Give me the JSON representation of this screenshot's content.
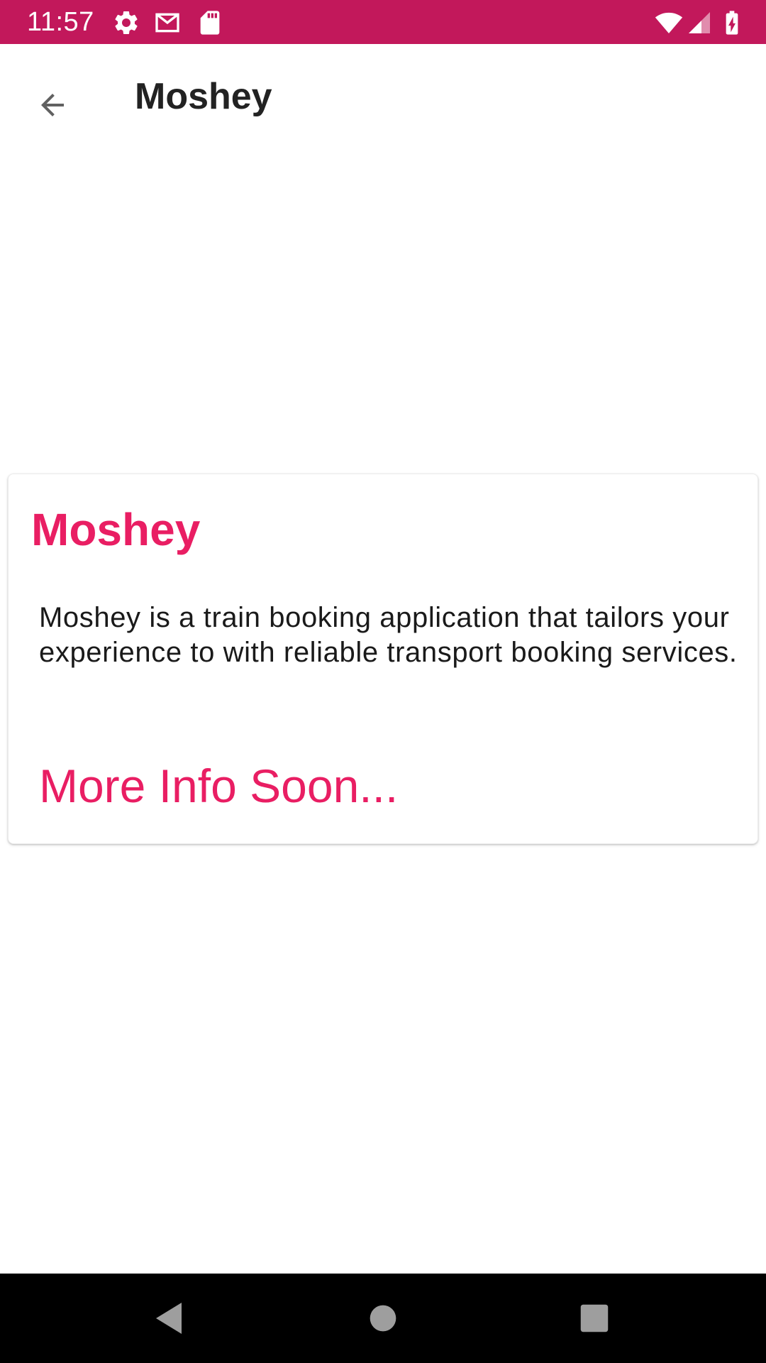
{
  "colors": {
    "status_bar": "#C2185B",
    "accent": "#E91E63",
    "nav_bar": "#000000",
    "nav_icon": "#9E9E9E"
  },
  "status_bar": {
    "time": "11:57",
    "left_icons": [
      "settings-icon",
      "gmail-icon",
      "sd-card-icon"
    ],
    "right_icons": [
      "wifi-icon",
      "cellular-signal-icon",
      "battery-charging-icon"
    ]
  },
  "app_bar": {
    "back_icon": "arrow-back-icon",
    "title": "Moshey"
  },
  "card": {
    "title": "Moshey",
    "description": "Moshey is a train booking application that tailors your experience to with reliable transport booking services.",
    "more_info": "More Info Soon..."
  },
  "nav_bar": {
    "buttons": [
      "back-triangle-icon",
      "home-circle-icon",
      "recents-square-icon"
    ]
  }
}
